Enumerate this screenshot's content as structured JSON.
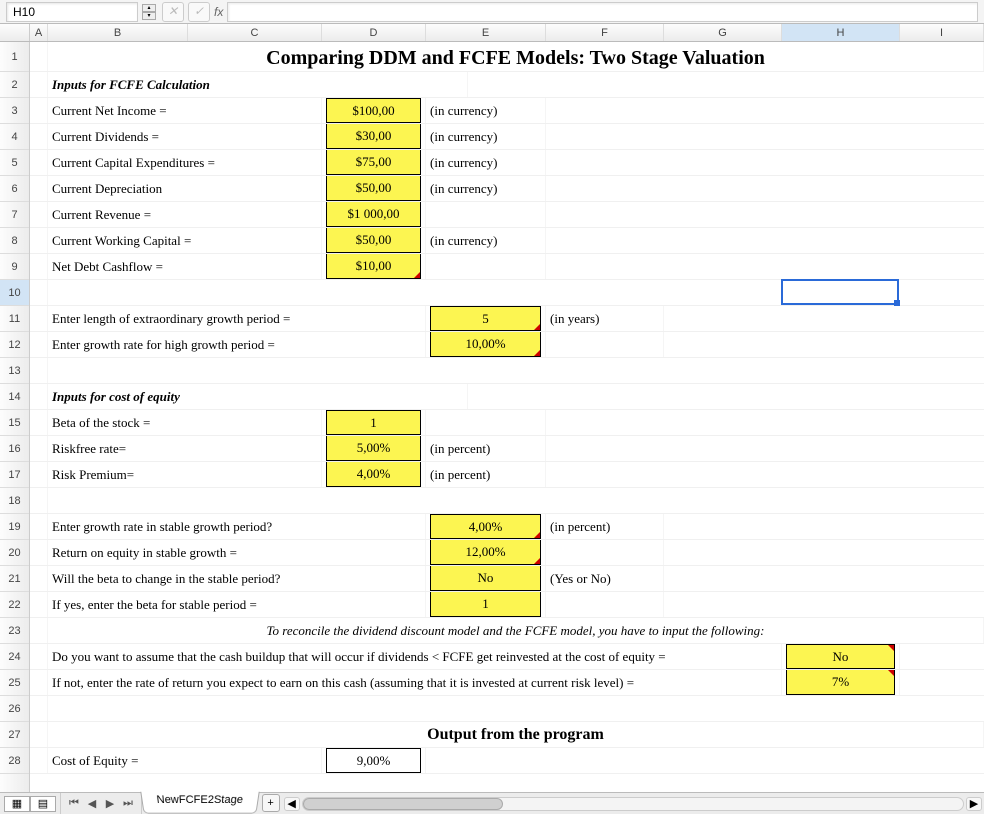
{
  "app": {
    "name_box": "H10",
    "fx_label": "fx",
    "formula": ""
  },
  "columns": [
    "A",
    "B",
    "C",
    "D",
    "E",
    "F",
    "G",
    "H",
    "I"
  ],
  "col_widths": {
    "A": 18,
    "B": 140,
    "C": 134,
    "D": 104,
    "E": 120,
    "F": 118,
    "G": 118,
    "H": 118,
    "I": 84
  },
  "rows": [
    1,
    2,
    3,
    4,
    5,
    6,
    7,
    8,
    9,
    10,
    11,
    12,
    13,
    14,
    15,
    16,
    17,
    18,
    19,
    20,
    21,
    22,
    23,
    24,
    25,
    26,
    27,
    28
  ],
  "active_cell": {
    "col": "H",
    "row": 10
  },
  "title": "Comparing DDM and FCFE Models: Two Stage Valuation",
  "section1": "Inputs for FCFE Calculation",
  "fcfe_inputs": [
    {
      "label": "Current Net Income =",
      "value": "$100,00",
      "unit": "(in currency)"
    },
    {
      "label": "Current Dividends =",
      "value": "$30,00",
      "unit": "(in currency)"
    },
    {
      "label": "Current Capital Expenditures =",
      "value": "$75,00",
      "unit": "(in currency)"
    },
    {
      "label": "Current Depreciation",
      "value": "$50,00",
      "unit": "(in currency)"
    },
    {
      "label": "Current Revenue =",
      "value": "$1 000,00",
      "unit": ""
    },
    {
      "label": "Current Working Capital =",
      "value": "$50,00",
      "unit": "(in currency)"
    },
    {
      "label": "Net Debt Cashflow =",
      "value": "$10,00",
      "unit": ""
    }
  ],
  "growth_inputs": [
    {
      "label": "Enter length of extraordinary growth period =",
      "value": "5",
      "unit": "(in years)"
    },
    {
      "label": "Enter growth rate for high growth period =",
      "value": "10,00%",
      "unit": ""
    }
  ],
  "section2": "Inputs for cost of equity",
  "equity_inputs": [
    {
      "label": "Beta of the stock =",
      "value": "1",
      "unit": ""
    },
    {
      "label": "Riskfree rate=",
      "value": "5,00%",
      "unit": "(in percent)"
    },
    {
      "label": "Risk Premium=",
      "value": "4,00%",
      "unit": "(in percent)"
    }
  ],
  "stable_inputs": [
    {
      "label": "Enter growth rate in stable growth period?",
      "value": "4,00%",
      "unit": "(in percent)"
    },
    {
      "label": "Return on equity in stable growth =",
      "value": "12,00%",
      "unit": ""
    },
    {
      "label": "Will the beta to change in the stable period?",
      "value": "No",
      "unit": "(Yes or No)"
    },
    {
      "label": "If yes, enter the beta for stable period =",
      "value": "1",
      "unit": ""
    }
  ],
  "reconcile_note": "To reconcile the dividend discount model and the FCFE model, you have to input the following:",
  "reconcile_q1": {
    "label": "Do you want to assume that the cash buildup that will occur if dividends < FCFE get reinvested at the cost of equity =",
    "value": "No"
  },
  "reconcile_q2": {
    "label": "If not, enter the rate of return you expect to earn on this cash (assuming that it is invested at current risk level) =",
    "value": "7%"
  },
  "output_hdr": "Output from the program",
  "output1": {
    "label": "Cost of Equity =",
    "value": "9,00%"
  },
  "sheet_tab": "NewFCFE2Stage",
  "icons": {
    "cancel": "✕",
    "confirm": "✓",
    "plus": "+",
    "chevL": "◀",
    "chevR": "▶",
    "barL": "⏮",
    "barR": "⏭"
  }
}
